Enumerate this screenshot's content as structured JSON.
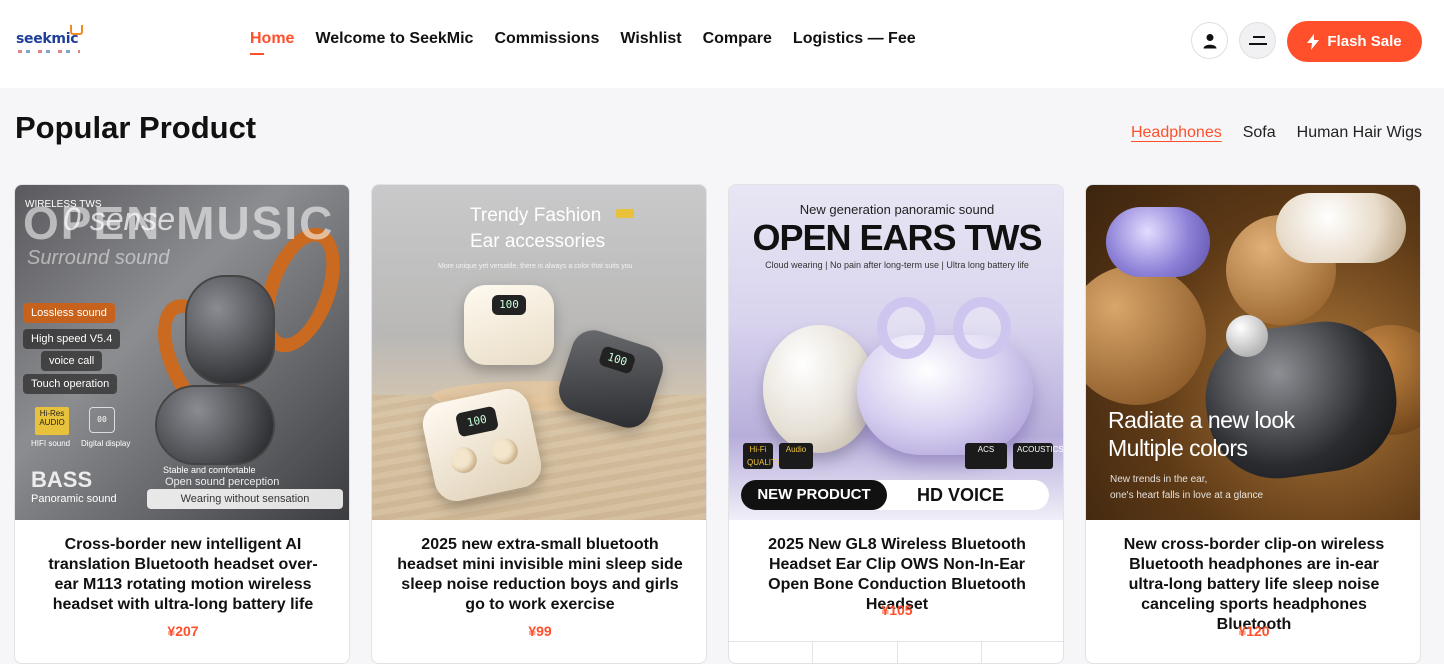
{
  "header": {
    "logo_text": "seekmic",
    "nav": [
      {
        "label": "Home",
        "active": true
      },
      {
        "label": "Welcome to SeekMic"
      },
      {
        "label": "Commissions"
      },
      {
        "label": "Wishlist"
      },
      {
        "label": "Compare"
      },
      {
        "label": "Logistics — Fee"
      }
    ],
    "flash_sale_label": "Flash Sale"
  },
  "section": {
    "title": "Popular Product",
    "tabs": [
      {
        "label": "Headphones",
        "active": true
      },
      {
        "label": "Sofa"
      },
      {
        "label": "Human Hair Wigs"
      }
    ]
  },
  "products": [
    {
      "title": "Cross-border new intelligent AI translation Bluetooth headset over-ear M113 rotating motion wireless headset with ultra-long battery life",
      "price": "¥207",
      "image_text": {
        "tag": "WIRELESS TWS",
        "big": "OPEN MUSIC",
        "sense": "0 sense",
        "surround": "Surround sound",
        "pills": [
          "Lossless sound",
          "High speed V5.4",
          "voice call",
          "Touch operation"
        ],
        "hires": "Hi-Res AUDIO",
        "hifi": "HIFI sound",
        "digital": "Digital display",
        "bass": "BASS",
        "panoramic": "Panoramic sound",
        "stable": "Stable and comfortable",
        "open_sound": "Open sound perception",
        "wearing": "Wearing without sensation"
      }
    },
    {
      "title": "2025 new extra-small bluetooth headset mini invisible mini sleep side sleep noise reduction boys and girls go to work exercise",
      "price": "¥99",
      "image_text": {
        "line1": "Trendy Fashion",
        "line2": "Ear accessories",
        "sub": "More unique yet versatile, there is always a color that suits you",
        "lcd1": "100",
        "lcd2": "100",
        "lcd3": "100"
      }
    },
    {
      "title": "2025 New GL8 Wireless Bluetooth Headset Ear Clip OWS Non-In-Ear Open Bone Conduction Bluetooth Headset",
      "price": "¥105",
      "image_text": {
        "top": "New generation panoramic sound",
        "big": "OPEN EARS TWS",
        "sub": "Cloud wearing | No pain after long-term use | Ultra long battery life",
        "badge1": "Hi-Fi QUALITY",
        "badge2": "Audio",
        "badge3": "ACS",
        "badge4": "ACOUSTICS",
        "new_product": "NEW PRODUCT",
        "hd_voice": "HD VOICE"
      }
    },
    {
      "title": "New cross-border clip-on wireless Bluetooth headphones are in-ear ultra-long battery life sleep noise canceling sports headphones Bluetooth",
      "price": "¥120",
      "image_text": {
        "line1": "Radiate a new look",
        "line2": "Multiple colors",
        "sub1": "New trends in the ear,",
        "sub2": "one's heart falls in love at a glance"
      }
    }
  ],
  "colors": {
    "accent": "#ff4f2b",
    "text": "#111111"
  }
}
